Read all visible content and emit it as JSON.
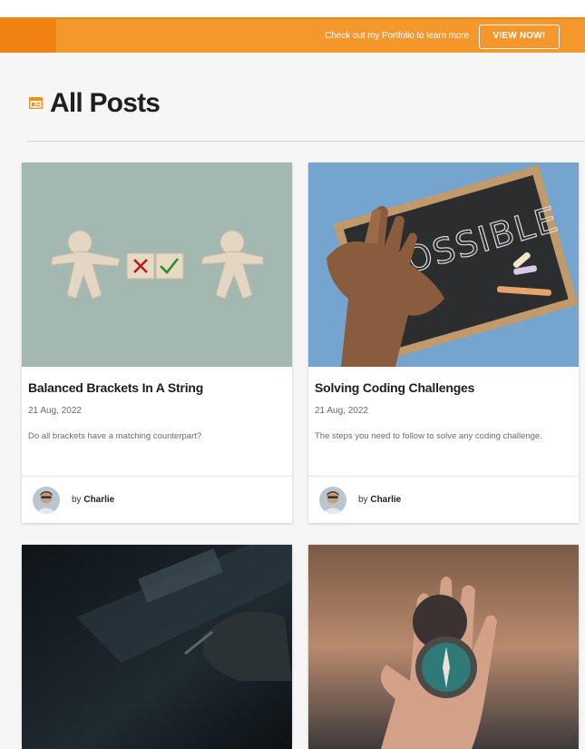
{
  "banner": {
    "message": "Check out my Portfolio to learn more",
    "button_label": "VIEW NOW!",
    "accent_color": "#f4982e"
  },
  "page": {
    "title": "All Posts",
    "title_icon": "posts-icon"
  },
  "posts": [
    {
      "title": "Balanced Brackets In A String",
      "date": "21 Aug, 2022",
      "excerpt": "Do all brackets have a matching counterpart?",
      "by": "by",
      "author": "Charlie"
    },
    {
      "title": "Solving Coding Challenges",
      "date": "21 Aug, 2022",
      "excerpt": "The steps you need to follow to solve any coding challenge.",
      "by": "by",
      "author": "Charlie"
    },
    {},
    {}
  ]
}
